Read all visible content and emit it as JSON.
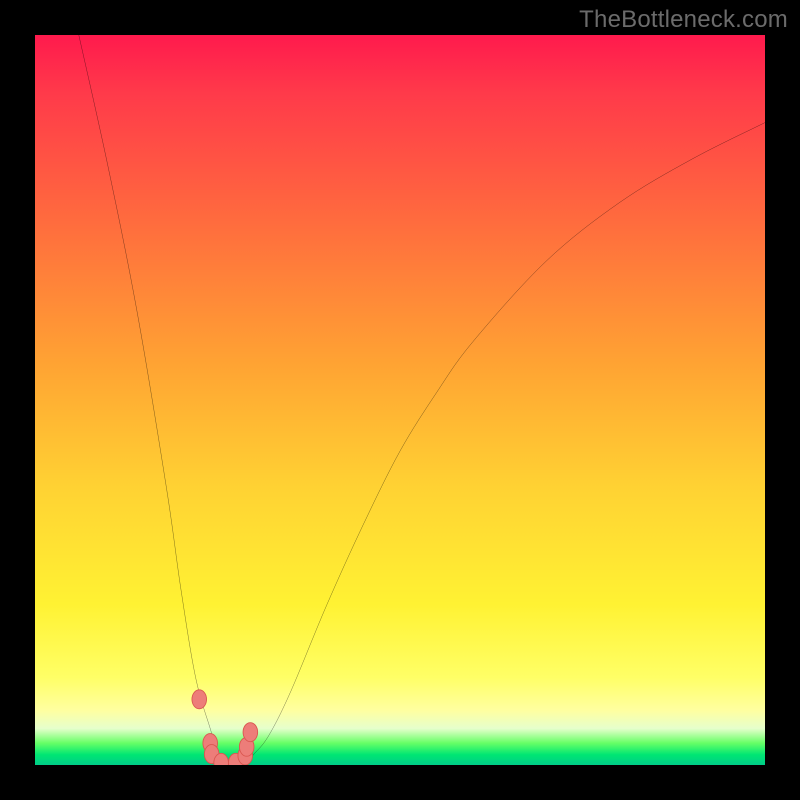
{
  "watermark": "TheBottleneck.com",
  "colors": {
    "background": "#000000",
    "curve": "#000000",
    "marker_fill": "#ed7d79",
    "marker_stroke": "#d9564f"
  },
  "chart_data": {
    "type": "line",
    "title": "",
    "xlabel": "",
    "ylabel": "",
    "xlim": [
      0,
      100
    ],
    "ylim": [
      0,
      100
    ],
    "note": "V-shaped bottleneck curve; axes are implied (no tick labels shown). y represents bottleneck % (high=red=bad, low=green=good). x is an implied hardware-balance axis. Values are visual estimates from the figure.",
    "series": [
      {
        "name": "bottleneck-curve",
        "x": [
          6,
          10,
          14,
          18,
          20,
          22,
          24,
          25,
          26,
          27,
          28,
          29,
          30,
          32,
          35,
          40,
          45,
          50,
          55,
          60,
          70,
          80,
          90,
          100
        ],
        "y": [
          100,
          82,
          62,
          38,
          24,
          12,
          5,
          2,
          0.5,
          0,
          0,
          0.5,
          1.5,
          4,
          10,
          22,
          33,
          43,
          51,
          58,
          69,
          77,
          83,
          88
        ]
      }
    ],
    "markers": {
      "name": "highlighted-points",
      "x": [
        22.5,
        24.0,
        24.2,
        25.5,
        27.5,
        28.8,
        29.0,
        29.5
      ],
      "y": [
        9.0,
        3.0,
        1.5,
        0.3,
        0.3,
        1.3,
        2.5,
        4.5
      ]
    }
  }
}
